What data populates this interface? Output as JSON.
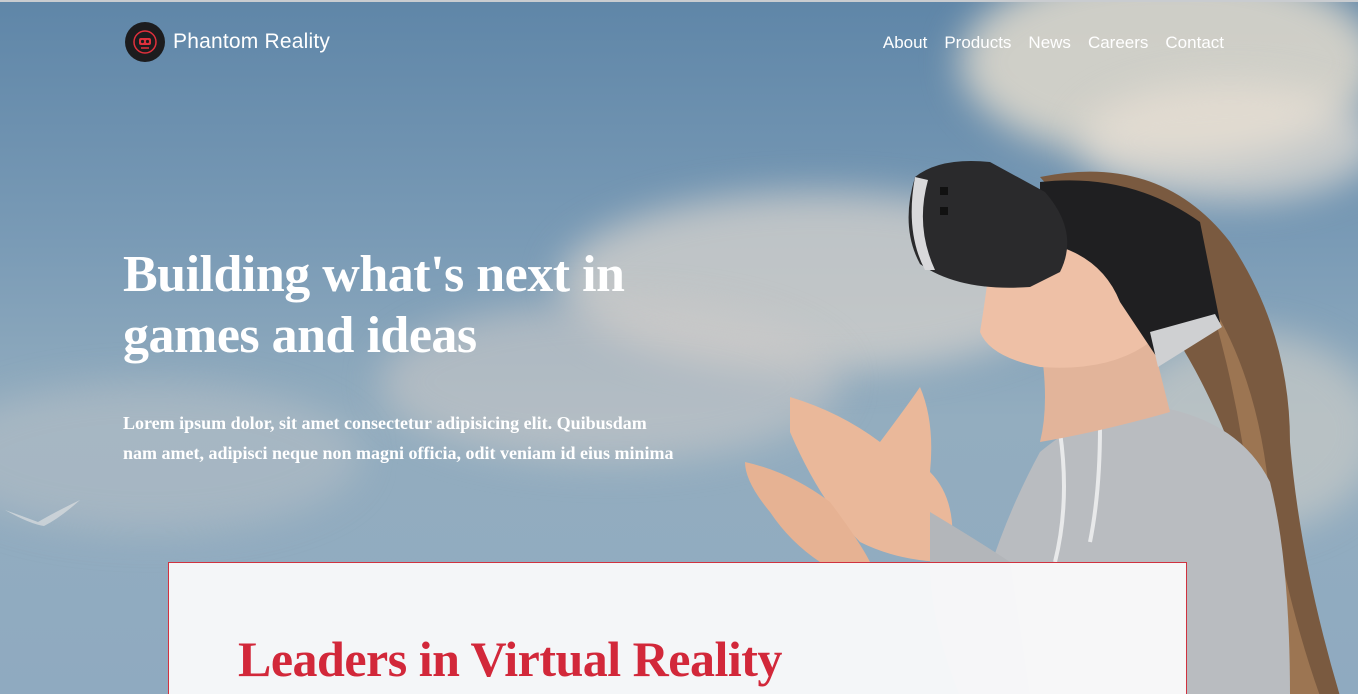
{
  "brand": {
    "name": "Phantom Reality",
    "logo_icon": "vr-mask-icon",
    "logo_color": "#e0303c"
  },
  "nav": {
    "items": [
      "About",
      "Products",
      "News",
      "Careers",
      "Contact"
    ]
  },
  "hero": {
    "headline": "Building what's next in games and ideas",
    "lead": "Lorem ipsum dolor, sit amet consectetur adipisicing elit. Quibusdam nam amet, adipisci neque non magni officia, odit veniam id eius minima"
  },
  "section": {
    "title": "Leaders in Virtual Reality",
    "accent_color": "#d2283a"
  }
}
